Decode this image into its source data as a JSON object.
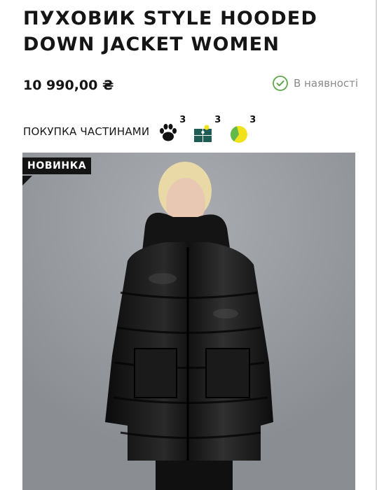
{
  "product": {
    "title": "ПУХОВИК STYLE HOODED DOWN JACKET WOMEN",
    "price": "10 990,00 ₴",
    "stock_status": "В наявності",
    "badge": "НОВИНКА"
  },
  "installments": {
    "label": "ПОКУПКА ЧАСТИНАМИ",
    "providers": [
      {
        "icon": "paw-icon",
        "count": "3"
      },
      {
        "icon": "puzzle-icon",
        "count": "3"
      },
      {
        "icon": "pie-chart-icon",
        "count": "3"
      }
    ]
  },
  "colors": {
    "check": "#5fa64a",
    "puzzle": "#1f5d54",
    "pie_yellow": "#f2e21b",
    "pie_green": "#61b949"
  }
}
